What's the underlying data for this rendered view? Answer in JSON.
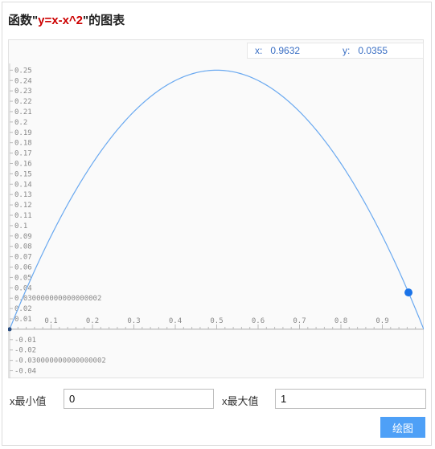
{
  "header": {
    "title_prefix": "函数\"",
    "title_expr": "y=x-x^2",
    "title_suffix": "\"的图表"
  },
  "readout": {
    "x_label": "x:",
    "x_value": "0.9632",
    "y_label": "y:",
    "y_value": "0.0355"
  },
  "controls": {
    "xmin_label": "x最小值",
    "xmin_value": "0",
    "xmax_label": "x最大值",
    "xmax_value": "1",
    "draw_button": "绘图"
  },
  "colors": {
    "curve": "#6aa9f0",
    "marker": "#1a73e8",
    "title_expr": "#cc0000",
    "button": "#4ea0f7"
  },
  "chart_data": {
    "type": "line",
    "function": "y=x-x^2",
    "xlim": [
      0,
      1
    ],
    "ylim": [
      -0.045,
      0.265
    ],
    "x_ticks": [
      "0.1",
      "0.2",
      "0.3",
      "0.4",
      "0.5",
      "0.6",
      "0.7",
      "0.8",
      "0.9"
    ],
    "y_ticks": [
      "0.25",
      "0.24",
      "0.23",
      "0.22",
      "0.21",
      "0.2",
      "0.19",
      "0.18",
      "0.17",
      "0.16",
      "0.15",
      "0.14",
      "0.13",
      "0.12",
      "0.11",
      "0.1",
      "0.09",
      "0.08",
      "0.07",
      "0.06",
      "0.05",
      "0.04",
      "0.030000000000000002",
      "0.02",
      "0.01",
      "-0.01",
      "-0.02",
      "-0.030000000000000002",
      "-0.04"
    ],
    "y_tick_values": [
      0.25,
      0.24,
      0.23,
      0.22,
      0.21,
      0.2,
      0.19,
      0.18,
      0.17,
      0.16,
      0.15,
      0.14,
      0.13,
      0.12,
      0.11,
      0.1,
      0.09,
      0.08,
      0.07,
      0.06,
      0.05,
      0.04,
      0.03,
      0.02,
      0.01,
      -0.01,
      -0.02,
      -0.03,
      -0.04
    ],
    "x_tick_values": [
      0.1,
      0.2,
      0.3,
      0.4,
      0.5,
      0.6,
      0.7,
      0.8,
      0.9
    ],
    "highlight_point": {
      "x": 0.9632,
      "y": 0.0355
    },
    "start_point": {
      "x": 0,
      "y": 0
    }
  }
}
